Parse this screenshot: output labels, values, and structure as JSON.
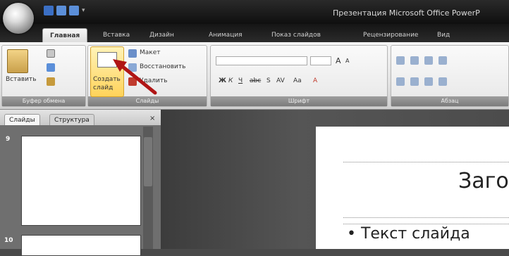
{
  "app": {
    "title": "Презентация Microsoft Office PowerP"
  },
  "tabs": [
    {
      "label": "Главная",
      "active": true
    },
    {
      "label": "Вставка"
    },
    {
      "label": "Дизайн"
    },
    {
      "label": "Анимация"
    },
    {
      "label": "Показ слайдов"
    },
    {
      "label": "Рецензирование"
    },
    {
      "label": "Вид"
    }
  ],
  "ribbon": {
    "clipboard": {
      "paste_label": "Вставить",
      "group_label": "Буфер обмена"
    },
    "slides": {
      "new_slide_label_1": "Создать",
      "new_slide_label_2": "слайд",
      "layout_label": "Макет",
      "reset_label": "Восстановить",
      "delete_label": "Удалить",
      "group_label": "Слайды"
    },
    "font": {
      "group_label": "Шрифт",
      "bold": "Ж",
      "italic": "К",
      "underline": "Ч",
      "strike": "abc",
      "shadow": "S",
      "spacing": "AV",
      "case": "Aa",
      "color": "A",
      "grow": "A",
      "shrink": "A"
    },
    "paragraph": {
      "group_label": "Абзац"
    }
  },
  "pane": {
    "tab_slides": "Слайды",
    "tab_outline": "Структура",
    "close": "×",
    "slide_numbers": [
      "9",
      "10"
    ]
  },
  "slide": {
    "title": "Заго",
    "body_bullet": "•",
    "body": "Текст слайда"
  },
  "colors": {
    "titlebar": "#111111",
    "ribbon": "#e3e3e3",
    "accent_arrow": "#b01515"
  }
}
